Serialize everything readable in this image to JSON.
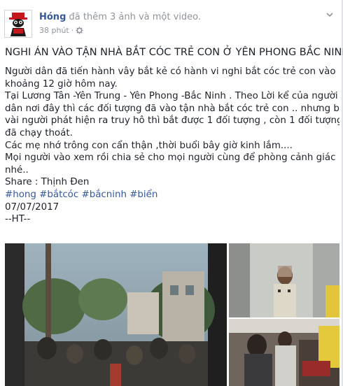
{
  "post": {
    "author": "Hóng",
    "action": "đã thêm 3 ảnh và một video.",
    "time": "38 phút",
    "audience_icon": "settings-icon",
    "headline": "NGHI ÁN VÀO TẬN NHÀ BẮT CÓC TRẺ CON Ở YÊN PHONG BẮC NINH",
    "lines": [
      "Người dân đã tiến hành vây bắt kẻ có hành vi nghi bắt cóc trẻ con vào",
      "khoảng 12 giờ hôm nay.",
      "Tại Lương Tân -Yên Trung - Yên Phong -Bắc Ninh . Theo Lời kể của người",
      "dân nơi đây thì các đối tượng đã vào tận nhà bắt cóc trẻ con .. nhưng bị",
      "vài người phát hiện ra truy hô thì bắt được 1 đối tượng , còn 1 đối tượng",
      "đã chạy thoát.",
      "Các mẹ nhớ trông con cẩn thận ,thời buổi bây giờ kinh lắm....",
      "Mọi người vào xem rồi chia sẻ cho mọi người cùng để phòng cảnh giác",
      "nhé..",
      "Share : Thịnh Đen"
    ],
    "hashtags": "#hong #bắtcóc #bắcninh #biển",
    "date": "07/07/2017",
    "signature": "--HT--"
  },
  "colors": {
    "link": "#365899",
    "text": "#1d2129",
    "muted": "#90949c"
  }
}
